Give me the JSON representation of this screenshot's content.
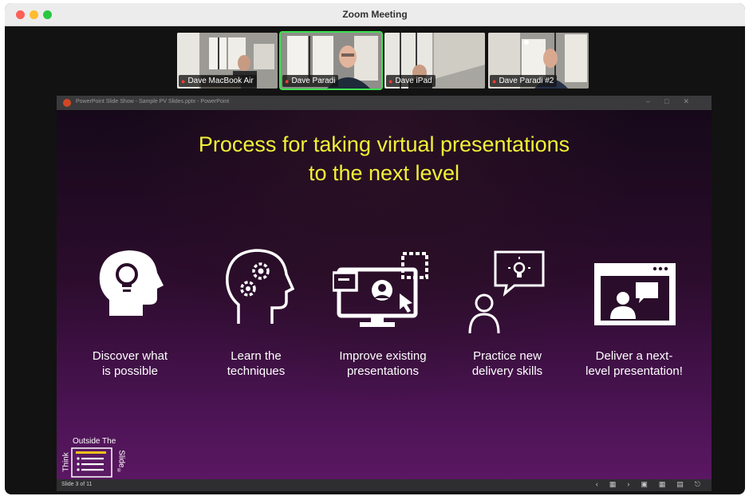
{
  "window": {
    "title": "Zoom Meeting"
  },
  "participants": [
    {
      "name": "Dave MacBook Air",
      "active": false
    },
    {
      "name": "Dave Paradi",
      "active": true
    },
    {
      "name": "Dave iPad",
      "active": false
    },
    {
      "name": "Dave Paradi #2",
      "active": false
    }
  ],
  "powerpoint": {
    "title": "PowerPoint Slide Show - Sample PV Slides.pptx - PowerPoint",
    "slide_counter": "Slide 3 of 11"
  },
  "slide": {
    "title_line1": "Process for taking virtual presentations",
    "title_line2": "to the next level",
    "steps": [
      {
        "line1": "Discover what",
        "line2": "is possible",
        "icon": "head-lightbulb-icon"
      },
      {
        "line1": "Learn the",
        "line2": "techniques",
        "icon": "head-gears-icon"
      },
      {
        "line1": "Improve existing",
        "line2": "presentations",
        "icon": "monitor-edit-icon"
      },
      {
        "line1": "Practice new",
        "line2": "delivery skills",
        "icon": "person-idea-icon"
      },
      {
        "line1": "Deliver a next-",
        "line2": "level presentation!",
        "icon": "video-presenter-icon"
      }
    ],
    "logo": {
      "top": "Outside The",
      "left": "Think",
      "right": "Slide",
      "mark": "®"
    }
  },
  "colors": {
    "title": "#f1f036",
    "active_speaker": "#3ee04f",
    "mute": "#ff3b30"
  }
}
